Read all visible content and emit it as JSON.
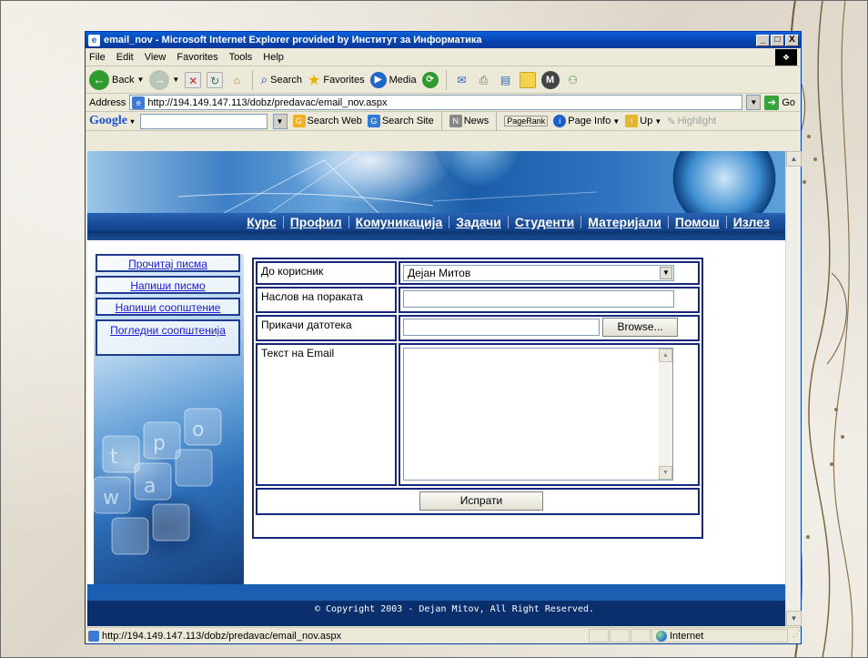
{
  "window": {
    "title": "email_nov - Microsoft Internet Explorer provided by Институт за Информатика",
    "min_label": "_",
    "max_label": "□",
    "close_label": "X"
  },
  "menubar": [
    "File",
    "Edit",
    "View",
    "Favorites",
    "Tools",
    "Help"
  ],
  "toolbar": {
    "back_label": "Back",
    "search_label": "Search",
    "favorites_label": "Favorites",
    "media_label": "Media"
  },
  "addressbar": {
    "label": "Address",
    "url": "http://194.149.147.113/dobz/predavac/email_nov.aspx",
    "go_label": "Go"
  },
  "googlebar": {
    "logo": "Google",
    "search_web_label": "Search Web",
    "search_site_label": "Search Site",
    "news_label": "News",
    "pagerank_label": "PageRank",
    "page_info_label": "Page Info",
    "up_label": "Up",
    "highlight_label": "Highlight"
  },
  "nav": [
    "Курс",
    "Профил",
    "Комуникација",
    "Задачи",
    "Студенти",
    "Материјали",
    "Помош",
    "Излез"
  ],
  "side_links": [
    "Прочитај писма",
    "Напиши писмо",
    "Напиши соопштение",
    "Погледни соопштенија"
  ],
  "form": {
    "to_label": "До корисник",
    "to_value": "Дејан Митов",
    "subject_label": "Наслов на пораката",
    "subject_value": "",
    "attach_label": "Прикачи датотека",
    "browse_label": "Browse...",
    "body_label": "Текст на Email",
    "submit_label": "Испрати"
  },
  "footer": {
    "copyright": "© Copyright 2003 - Dejan Mitov, All Right Reserved."
  },
  "statusbar": {
    "url": "http://194.149.147.113/dobz/predavac/email_nov.aspx",
    "zone": "Internet"
  }
}
